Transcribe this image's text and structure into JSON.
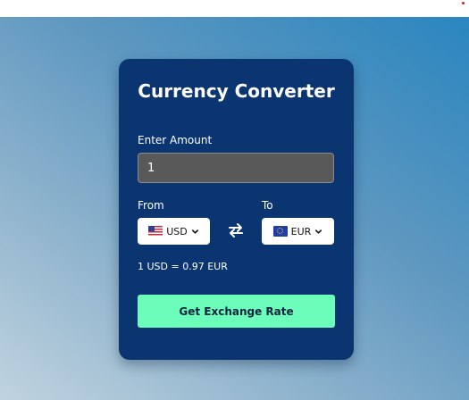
{
  "converter": {
    "title": "Currency Converter",
    "amount_label": "Enter Amount",
    "amount_value": "1",
    "from_label": "From",
    "to_label": "To",
    "from_currency": "USD",
    "to_currency": "EUR",
    "from_flag": "us-flag-icon",
    "to_flag": "eu-flag-icon",
    "swap_icon": "swap-arrows-icon",
    "rate_text": "1 USD = 0.97 EUR",
    "button_label": "Get Exchange Rate"
  },
  "colors": {
    "card_bg": "#0b3571",
    "button_bg": "#6bfdb9",
    "input_bg": "#595959"
  }
}
